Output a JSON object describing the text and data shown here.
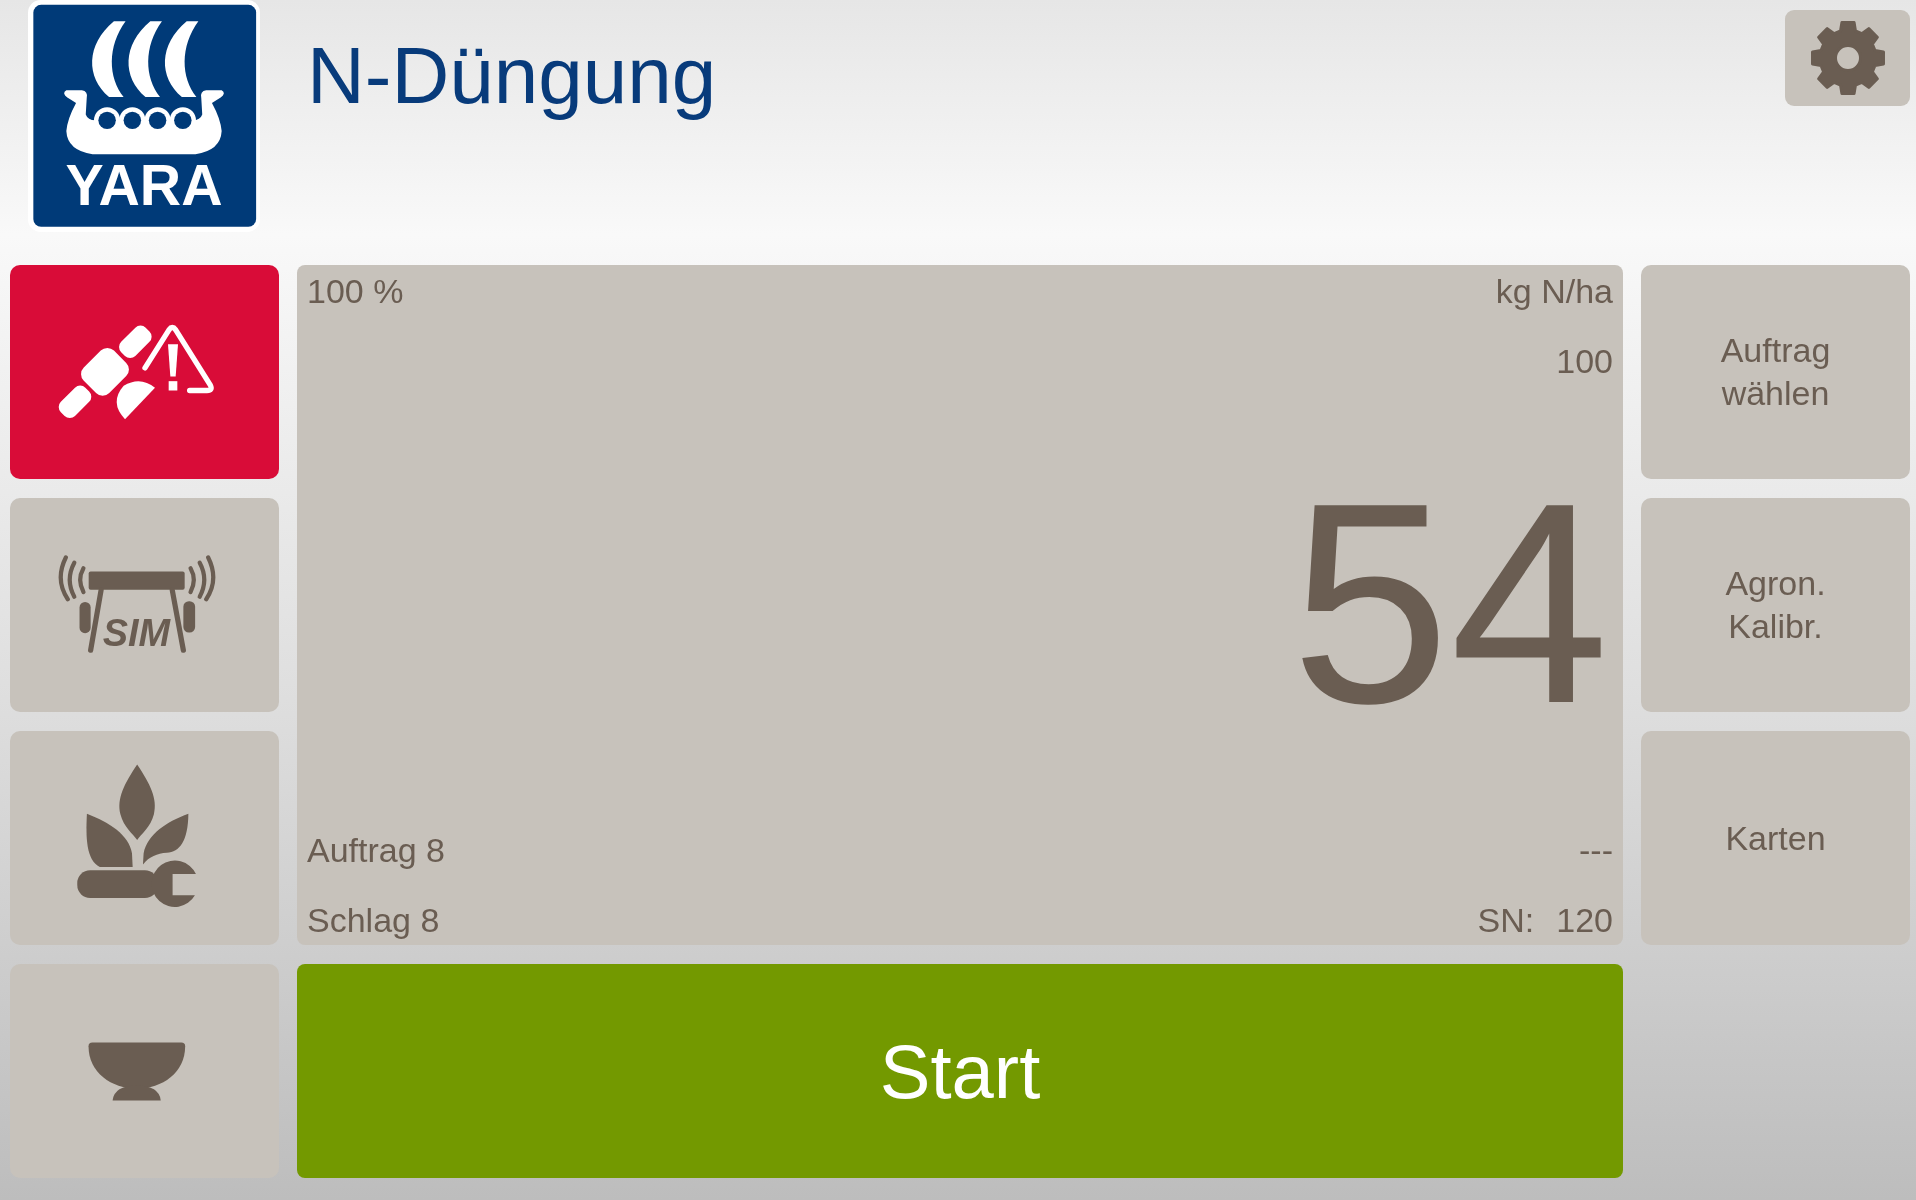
{
  "header": {
    "logo_text": "YARA",
    "title": "N-Düngung"
  },
  "left_buttons": [
    {
      "kind": "satellite",
      "alert": true
    },
    {
      "kind": "simulator",
      "alert": false,
      "label": "SIM"
    },
    {
      "kind": "plant",
      "alert": false
    },
    {
      "kind": "bowl",
      "alert": false
    }
  ],
  "rate_panel": {
    "rate_percent": "100 %",
    "unit": "kg N/ha",
    "set_rate": "100",
    "current_rate": "54",
    "job": "Auftrag 8",
    "job_status": "---",
    "field": "Schlag 8",
    "sn_label": "SN:",
    "sn_value": "120"
  },
  "start_button": {
    "label": "Start"
  },
  "right_buttons": [
    {
      "label": "Auftrag\nwählen"
    },
    {
      "label": "Agron.\nKalibr."
    },
    {
      "label": "Karten"
    }
  ]
}
